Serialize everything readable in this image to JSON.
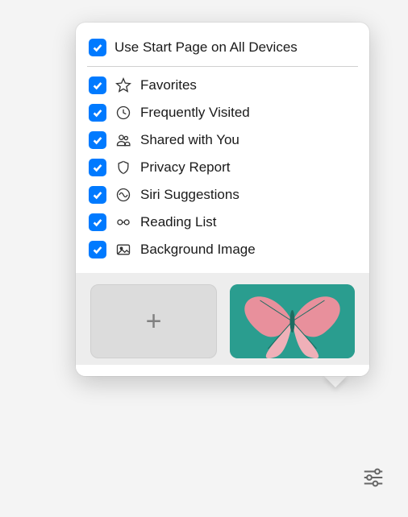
{
  "header": {
    "use_start_page_label": "Use Start Page on All Devices",
    "use_start_page_checked": true
  },
  "options": [
    {
      "id": "favorites",
      "label": "Favorites",
      "checked": true,
      "icon": "star-icon"
    },
    {
      "id": "frequently-visited",
      "label": "Frequently Visited",
      "checked": true,
      "icon": "clock-icon"
    },
    {
      "id": "shared-with-you",
      "label": "Shared with You",
      "checked": true,
      "icon": "people-icon"
    },
    {
      "id": "privacy-report",
      "label": "Privacy Report",
      "checked": true,
      "icon": "shield-icon"
    },
    {
      "id": "siri-suggestions",
      "label": "Siri Suggestions",
      "checked": true,
      "icon": "siri-icon"
    },
    {
      "id": "reading-list",
      "label": "Reading List",
      "checked": true,
      "icon": "glasses-icon"
    },
    {
      "id": "background-image",
      "label": "Background Image",
      "checked": true,
      "icon": "image-icon"
    }
  ],
  "background_tiles": {
    "add_label": "+",
    "preset_name": "butterfly"
  },
  "colors": {
    "accent": "#007aff"
  }
}
